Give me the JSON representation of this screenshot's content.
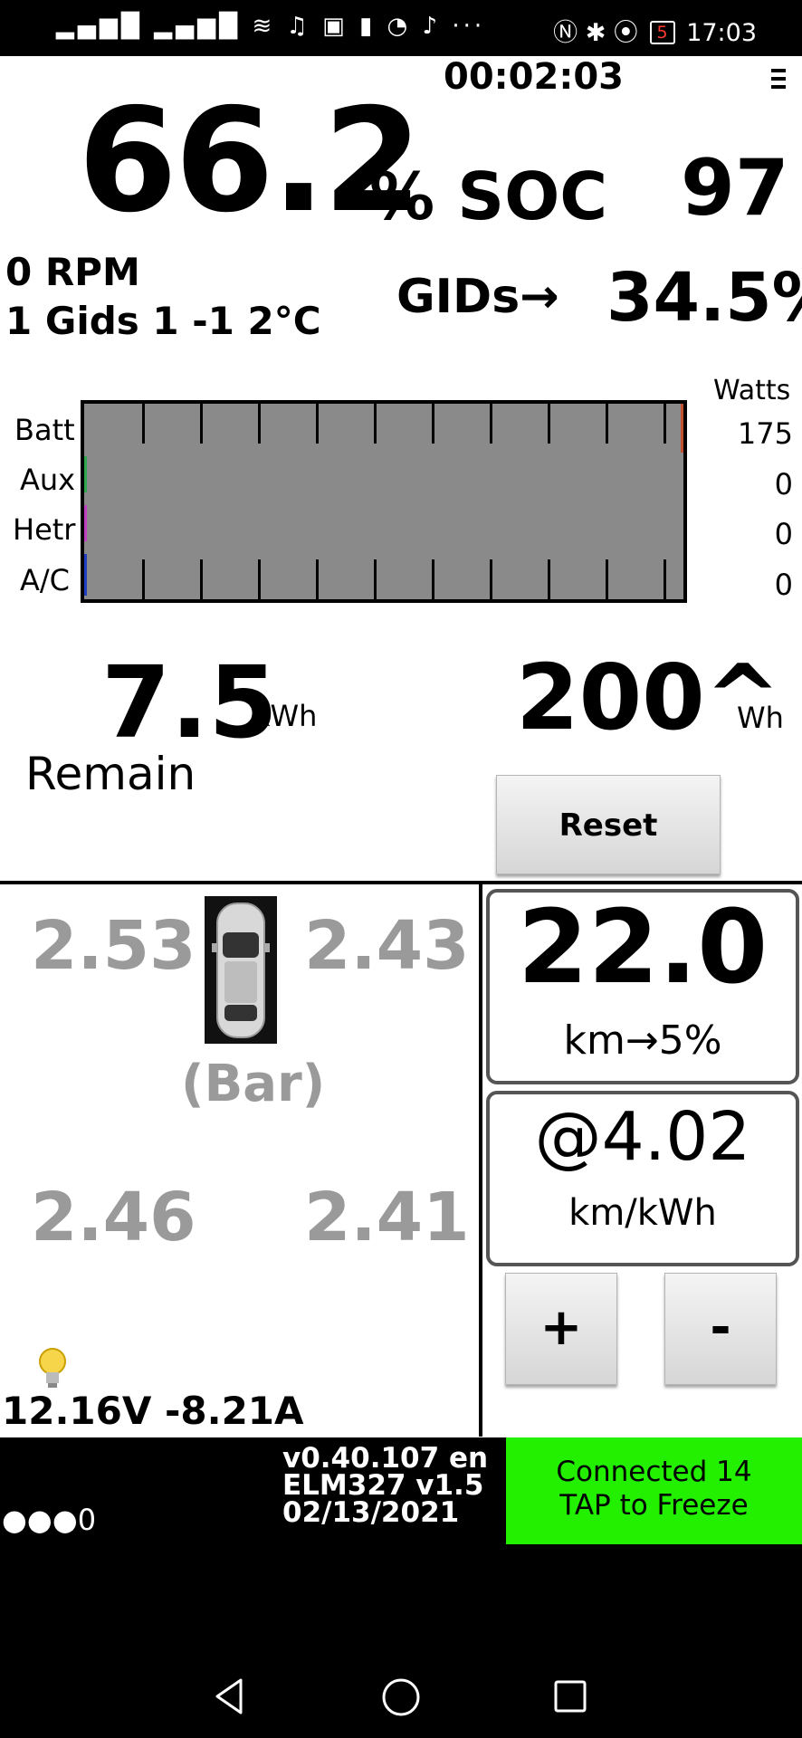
{
  "status_bar": {
    "left_icons": "▂▄▆█ ▂▄▆█ ≋ ♫ ▣ ▮ ◔ ♪ ···",
    "right_icons": "Ⓝ ✱ ⦿",
    "battery": "5",
    "time": "17:03"
  },
  "timer": "00:02:03",
  "soc": {
    "value": "66.2",
    "label": "% SOC",
    "right_value": "97"
  },
  "info": {
    "rpm": "0 RPM",
    "gids_line": "1 Gids 1 -1 2°C",
    "gids_label": "GIDs→",
    "gids_pct": "34.5%"
  },
  "gauge": {
    "rows": [
      "Batt",
      "Aux",
      "Hetr",
      "A/C"
    ],
    "watts_title": "Watts",
    "watts": [
      "175",
      "0",
      "0",
      "0"
    ],
    "bar_colors": {
      "aux": "#2fa84f",
      "hetr": "#c040c0",
      "ac": "#2040c0",
      "batt_end": "#c05030"
    }
  },
  "energy": {
    "kwh_value": "7.5",
    "kwh_unit": "kWh",
    "remain": "Remain",
    "wh_value": "200^",
    "wh_unit": "Wh",
    "reset": "Reset"
  },
  "tires": {
    "fl": "2.53",
    "fr": "2.43",
    "rl": "2.46",
    "rr": "2.41",
    "unit": "(Bar)"
  },
  "electrical": {
    "volt_amp": "12.16V -8.21A"
  },
  "range": {
    "value": "22.0",
    "sub": "km→5%"
  },
  "efficiency": {
    "value": "@4.02",
    "unit": "km/kWh"
  },
  "buttons": {
    "plus": "+",
    "minus": "-"
  },
  "footer": {
    "dots": "●●●0",
    "version_line1": "v0.40.107 en",
    "version_line2": "ELM327 v1.5",
    "version_line3": "02/13/2021",
    "connected_line1": "Connected 14",
    "connected_line2": "TAP to Freeze",
    "connected_color": "#22f000"
  },
  "navbar": {
    "back": "back-icon",
    "home": "home-icon",
    "recents": "recents-icon"
  }
}
